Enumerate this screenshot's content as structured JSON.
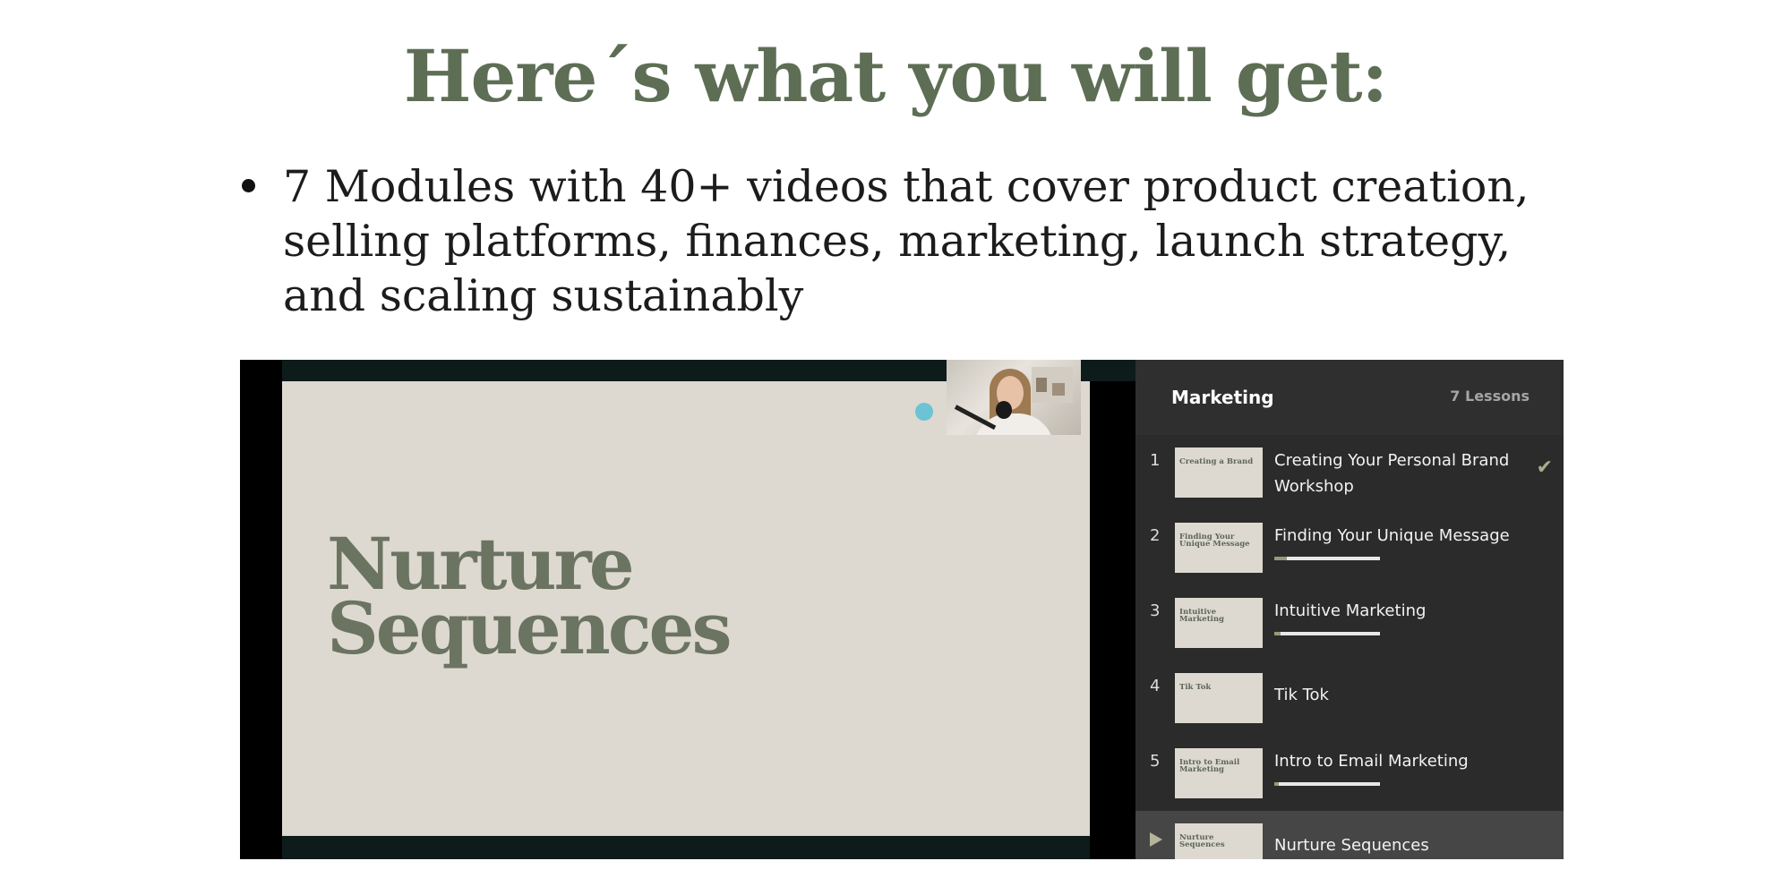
{
  "headline": "Here´s what you will get:",
  "bullets": [
    "7 Modules with 40+ videos that cover product creation, selling platforms, finances, marketing, launch strategy, and scaling sustainably"
  ],
  "video": {
    "slide_title_line1": "Nurture",
    "slide_title_line2": "Sequences"
  },
  "sidebar": {
    "title": "Marketing",
    "lesson_count": "7 Lessons",
    "lessons": [
      {
        "num": "1",
        "thumb": "Creating a Brand",
        "title": "Creating Your Personal Brand Workshop",
        "completed": true
      },
      {
        "num": "2",
        "thumb": "Finding Your Unique Message",
        "title": "Finding Your Unique Message",
        "progress": 0.12
      },
      {
        "num": "3",
        "thumb": "Intuitive Marketing",
        "title": "Intuitive Marketing",
        "progress": 0.06
      },
      {
        "num": "4",
        "thumb": "Tik Tok",
        "title": "Tik Tok"
      },
      {
        "num": "5",
        "thumb": "Intro to Email Marketing",
        "title": "Intro to Email Marketing",
        "progress": 0.04
      },
      {
        "num": "",
        "thumb": "Nurture Sequences",
        "title": "Nurture Sequences",
        "playing": true
      }
    ]
  },
  "colors": {
    "accent_green": "#5d6e55",
    "progress_fill": "#8f9e79",
    "sidebar_bg": "#2b2b2b",
    "slide_bg": "#ddd9d0"
  },
  "icons": [
    "checkmark-icon",
    "play-icon",
    "pointer-dot-icon"
  ]
}
